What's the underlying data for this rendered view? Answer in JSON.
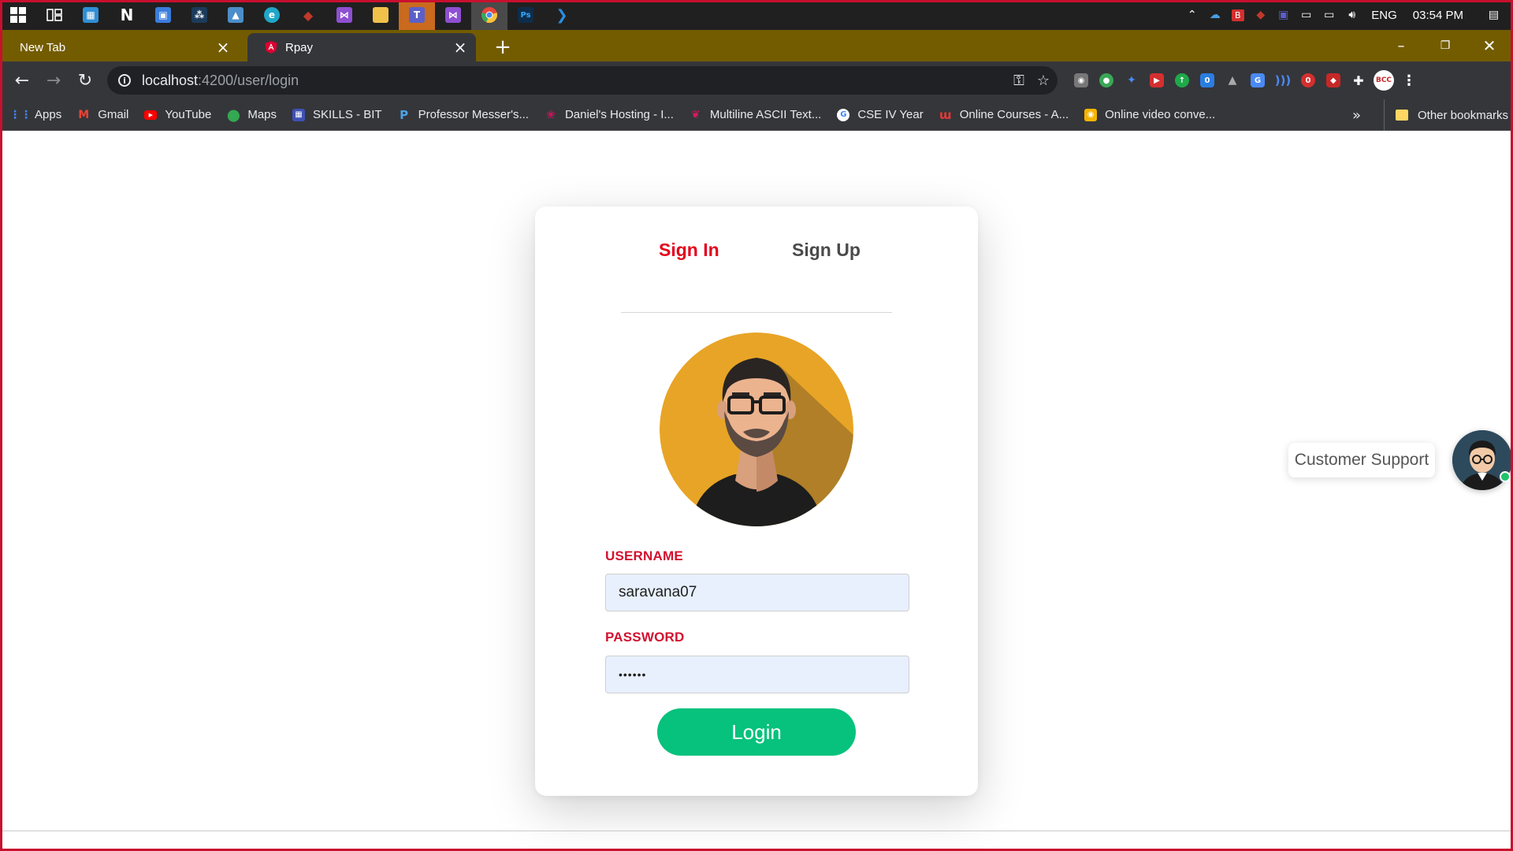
{
  "taskbar": {
    "apps": [
      {
        "name": "start-icon",
        "color": "#ffffff"
      },
      {
        "name": "task-view-icon",
        "color": "#ffffff"
      },
      {
        "name": "app-icon-1",
        "color": "#2f8fd6"
      },
      {
        "name": "notion-icon",
        "color": "#ffffff"
      },
      {
        "name": "app-icon-3",
        "color": "#3b7ddd"
      },
      {
        "name": "app-icon-4",
        "color": "#1c3b5a"
      },
      {
        "name": "photos-icon",
        "color": "#4b8ec9"
      },
      {
        "name": "edge-icon",
        "color": "#1fa7c9"
      },
      {
        "name": "app-icon-7",
        "color": "#c0392b"
      },
      {
        "name": "visual-studio-icon",
        "color": "#8e4fd1"
      },
      {
        "name": "file-explorer-icon",
        "color": "#f0c24a"
      },
      {
        "name": "teams-icon",
        "color": "#5b5fc7"
      },
      {
        "name": "visual-studio-2-icon",
        "color": "#8e4fd1"
      },
      {
        "name": "chrome-icon",
        "color": "#e8453c"
      },
      {
        "name": "photoshop-icon",
        "color": "#0f2d4a"
      },
      {
        "name": "vscode-icon",
        "color": "#2a8ee0"
      }
    ],
    "language": "ENG",
    "time": "03:54 PM"
  },
  "tabs": {
    "new_tab_label": "New Tab",
    "active_tab_label": "Rpay"
  },
  "address_bar": {
    "host": "localhost",
    "path": ":4200/user/login"
  },
  "bookmarks": {
    "items": [
      {
        "label": "Apps",
        "color": "#4285f4"
      },
      {
        "label": "Gmail",
        "color": "#ea4335"
      },
      {
        "label": "YouTube",
        "color": "#ff0000"
      },
      {
        "label": "Maps",
        "color": "#34a853"
      },
      {
        "label": "SKILLS - BIT",
        "color": "#3f51b5"
      },
      {
        "label": "Professor Messer's...",
        "color": "#1e6fb8"
      },
      {
        "label": "Daniel's Hosting - I...",
        "color": "#a3123a"
      },
      {
        "label": "Multiline ASCII Text...",
        "color": "#d81b60"
      },
      {
        "label": "CSE IV Year",
        "color": "#ffffff"
      },
      {
        "label": "Online Courses - A...",
        "color": "#e53935"
      },
      {
        "label": "Online video conve...",
        "color": "#f4b400"
      }
    ],
    "more_label": "»",
    "other_label": "Other bookmarks"
  },
  "login": {
    "tab_signin": "Sign In",
    "tab_signup": "Sign Up",
    "username_label": "USERNAME",
    "username_value": "saravana07",
    "password_label": "PASSWORD",
    "password_value": "••••••",
    "login_button": "Login",
    "accent_color": "#e3001b",
    "button_color": "#06c27c"
  },
  "support": {
    "label": "Customer Support"
  }
}
